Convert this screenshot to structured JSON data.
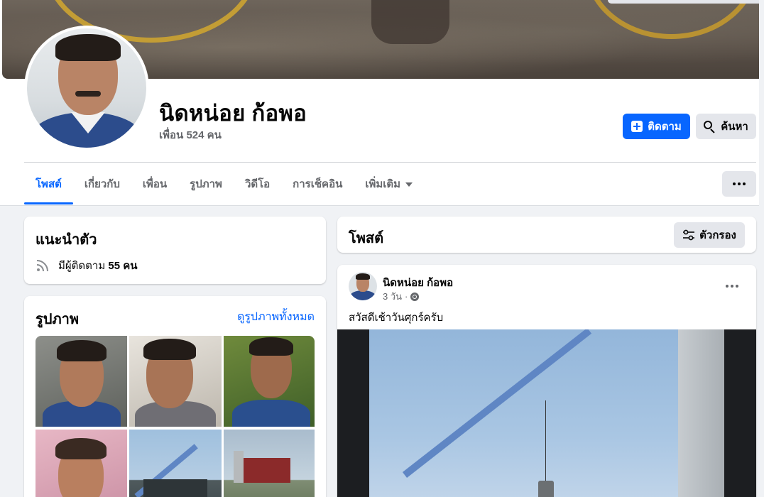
{
  "profile": {
    "name": "นิดหน่อย ก้อพอ",
    "friends": "เพื่อน 524 คน"
  },
  "actions": {
    "follow_label": "ติดตาม",
    "search_label": "ค้นหา"
  },
  "tabs": [
    {
      "label": "โพสต์",
      "active": true
    },
    {
      "label": "เกี่ยวกับ",
      "active": false
    },
    {
      "label": "เพื่อน",
      "active": false
    },
    {
      "label": "รูปภาพ",
      "active": false
    },
    {
      "label": "วิดีโอ",
      "active": false
    },
    {
      "label": "การเช็คอิน",
      "active": false
    },
    {
      "label": "เพิ่มเติม",
      "active": false
    }
  ],
  "intro": {
    "title": "แนะนำตัว",
    "followers_prefix": "มีผู้ติดตาม",
    "followers_count": "55 คน",
    "icon": "rss-feed-icon"
  },
  "photos": {
    "title": "รูปภาพ",
    "see_all": "ดูรูปภาพทั้งหมด"
  },
  "posts_section": {
    "title": "โพสต์",
    "filter_label": "ตัวกรอง"
  },
  "post": {
    "author": "นิดหน่อย ก้อพอ",
    "time": "3 วัน",
    "separator": "·",
    "privacy_icon": "globe-icon",
    "text": "สวัสดีเช้าวันศุกร์ครับ"
  },
  "colors": {
    "accent": "#0866ff",
    "page_bg": "#f0f2f5",
    "secondary_text": "#65676b",
    "button_gray": "#e4e6eb"
  }
}
